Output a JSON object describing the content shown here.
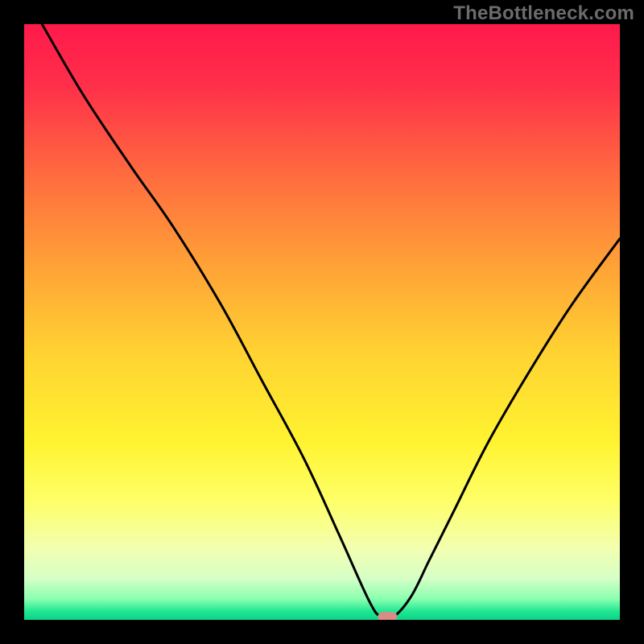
{
  "watermark": "TheBottleneck.com",
  "chart_data": {
    "type": "line",
    "title": "",
    "xlabel": "",
    "ylabel": "",
    "xlim": [
      0,
      100
    ],
    "ylim": [
      0,
      100
    ],
    "grid": false,
    "legend": false,
    "series": [
      {
        "name": "curve",
        "x": [
          3,
          10,
          18,
          25,
          33,
          40,
          47,
          53,
          58,
          60,
          62,
          65,
          68,
          72,
          78,
          85,
          92,
          100
        ],
        "y": [
          100,
          88,
          76,
          66,
          53,
          40,
          27,
          14,
          3,
          0.5,
          0.5,
          4,
          10,
          18,
          30,
          42,
          53,
          64
        ]
      }
    ],
    "marker": {
      "x": 61,
      "y": 0.5,
      "color": "#d98b86"
    },
    "background_gradient": {
      "stops": [
        {
          "offset": 0.0,
          "color": "#ff1a4b"
        },
        {
          "offset": 0.1,
          "color": "#ff2e4a"
        },
        {
          "offset": 0.25,
          "color": "#ff6a3f"
        },
        {
          "offset": 0.4,
          "color": "#ffa037"
        },
        {
          "offset": 0.55,
          "color": "#ffd232"
        },
        {
          "offset": 0.7,
          "color": "#fff330"
        },
        {
          "offset": 0.8,
          "color": "#feff67"
        },
        {
          "offset": 0.88,
          "color": "#f2ffb0"
        },
        {
          "offset": 0.93,
          "color": "#d6ffc6"
        },
        {
          "offset": 0.965,
          "color": "#8affb0"
        },
        {
          "offset": 0.985,
          "color": "#22e893"
        },
        {
          "offset": 1.0,
          "color": "#0bd488"
        }
      ]
    },
    "stroke": {
      "color": "#000000",
      "width": 3
    }
  }
}
